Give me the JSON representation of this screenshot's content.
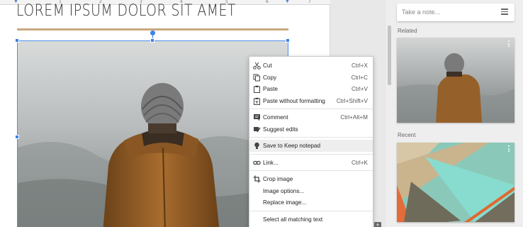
{
  "ruler": {
    "numbers": [
      "1",
      "2",
      "3",
      "4",
      "5",
      "6",
      "7"
    ]
  },
  "document": {
    "title": "LOREM IPSUM DOLOR SIT AMET"
  },
  "sidebar": {
    "note_placeholder": "Take a note...",
    "related_label": "Related",
    "recent_label": "Recent"
  },
  "context_menu": {
    "items": [
      {
        "label": "Cut",
        "shortcut": "Ctrl+X",
        "icon": "scissors-icon"
      },
      {
        "label": "Copy",
        "shortcut": "Ctrl+C",
        "icon": "copy-icon"
      },
      {
        "label": "Paste",
        "shortcut": "Ctrl+V",
        "icon": "paste-icon"
      },
      {
        "label": "Paste without formatting",
        "shortcut": "Ctrl+Shift+V",
        "icon": "paste-plain-icon"
      },
      {
        "label": "Comment",
        "shortcut": "Ctrl+Alt+M",
        "icon": "comment-icon"
      },
      {
        "label": "Suggest edits",
        "shortcut": "",
        "icon": "suggest-edits-icon"
      },
      {
        "label": "Save to Keep notepad",
        "shortcut": "",
        "icon": "lightbulb-icon"
      },
      {
        "label": "Link...",
        "shortcut": "Ctrl+K",
        "icon": "link-icon"
      },
      {
        "label": "Crop image",
        "shortcut": "",
        "icon": "crop-icon"
      },
      {
        "label": "Image options...",
        "shortcut": "",
        "icon": ""
      },
      {
        "label": "Replace image...",
        "shortcut": "",
        "icon": ""
      },
      {
        "label": "Select all matching text",
        "shortcut": "",
        "icon": ""
      }
    ]
  },
  "colors": {
    "accent": "#3f82e8",
    "title_rule": "#c8a97f",
    "menu_highlight": "#eeeeee"
  }
}
